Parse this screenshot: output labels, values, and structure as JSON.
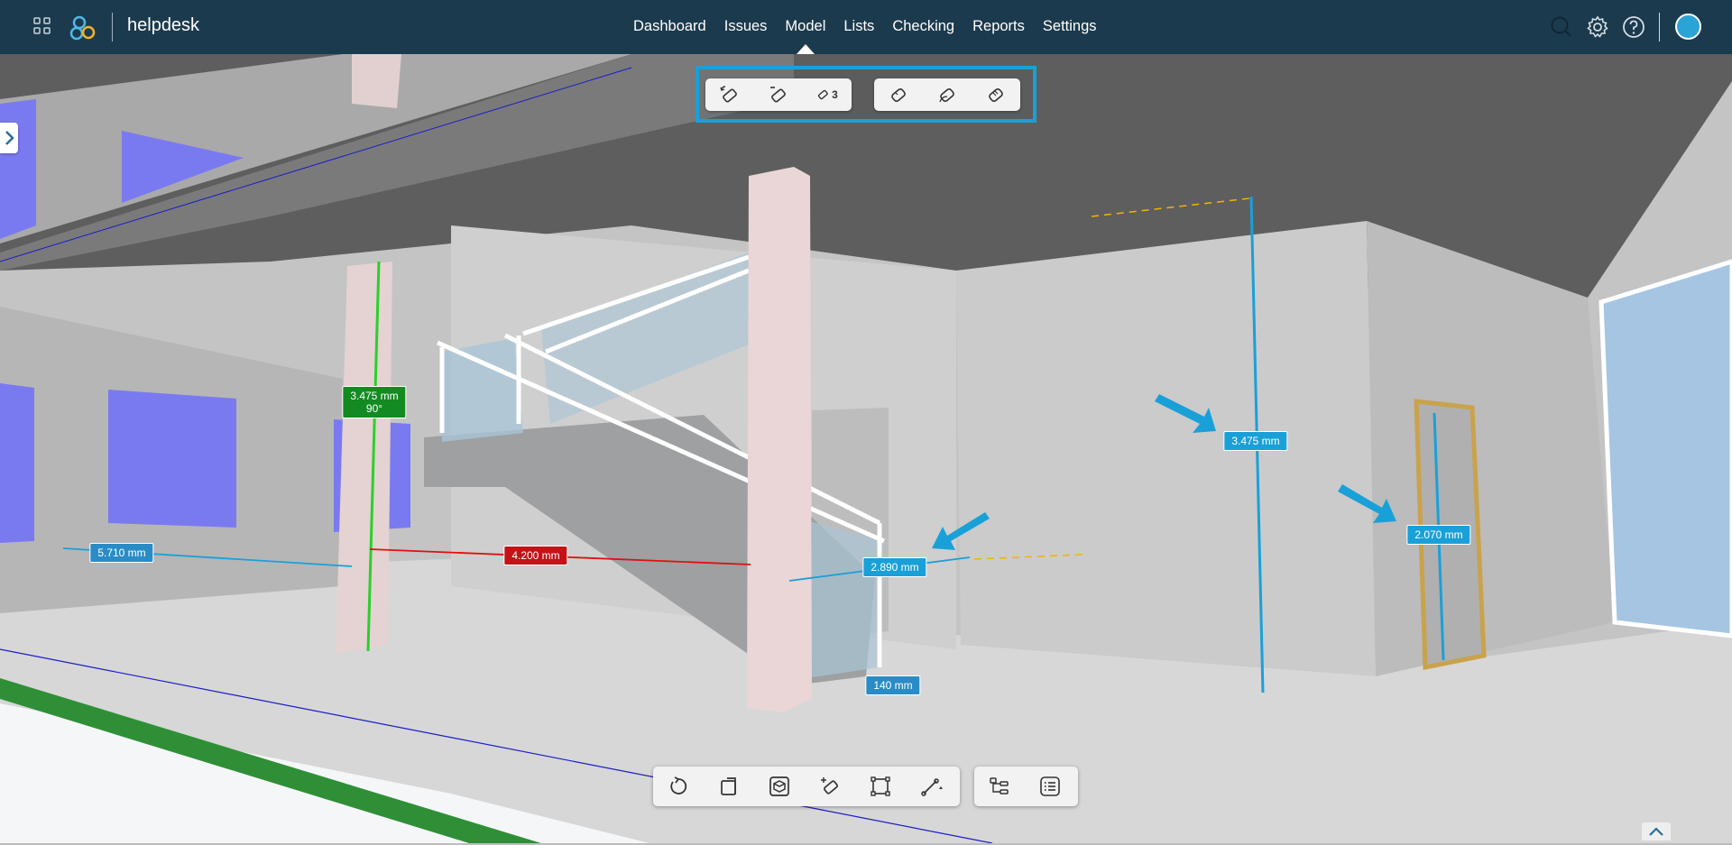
{
  "header": {
    "app_name": "helpdesk",
    "nav": [
      {
        "label": "Dashboard",
        "active": false
      },
      {
        "label": "Issues",
        "active": false
      },
      {
        "label": "Model",
        "active": true
      },
      {
        "label": "Lists",
        "active": false
      },
      {
        "label": "Checking",
        "active": false
      },
      {
        "label": "Reports",
        "active": false
      },
      {
        "label": "Settings",
        "active": false
      }
    ],
    "icons": [
      "apps-grid-icon",
      "helpdesk-logo",
      "search-icon",
      "gear-icon",
      "help-icon",
      "user-avatar"
    ]
  },
  "measure_toolbar": {
    "measure_count": "3",
    "group1": [
      "measure-undo-icon",
      "measure-remove-icon",
      "measure-list-icon"
    ],
    "group2": [
      "tape-measure-icon",
      "tape-angle-icon",
      "tape-clear-icon"
    ]
  },
  "bottom_toolbar": {
    "group1": [
      "reset-view-icon",
      "section-plane-icon",
      "box-view-icon",
      "add-measure-icon",
      "select-area-icon",
      "draw-line-icon"
    ],
    "group2": [
      "model-tree-icon",
      "properties-list-icon"
    ]
  },
  "measurements": {
    "column_height": "3.475 mm",
    "column_angle": "90°",
    "left_distance": "5.710 mm",
    "stair_distance": "4.200 mm",
    "wall_distance": "2.890 mm",
    "wall_height": "3.475 mm",
    "door_height": "2.070 mm",
    "step_height": "140 mm"
  },
  "colors": {
    "header_bg": "#1c3a4d",
    "accent": "#1aa0d8",
    "measure_green": "#138a22",
    "measure_red": "#c41216"
  }
}
